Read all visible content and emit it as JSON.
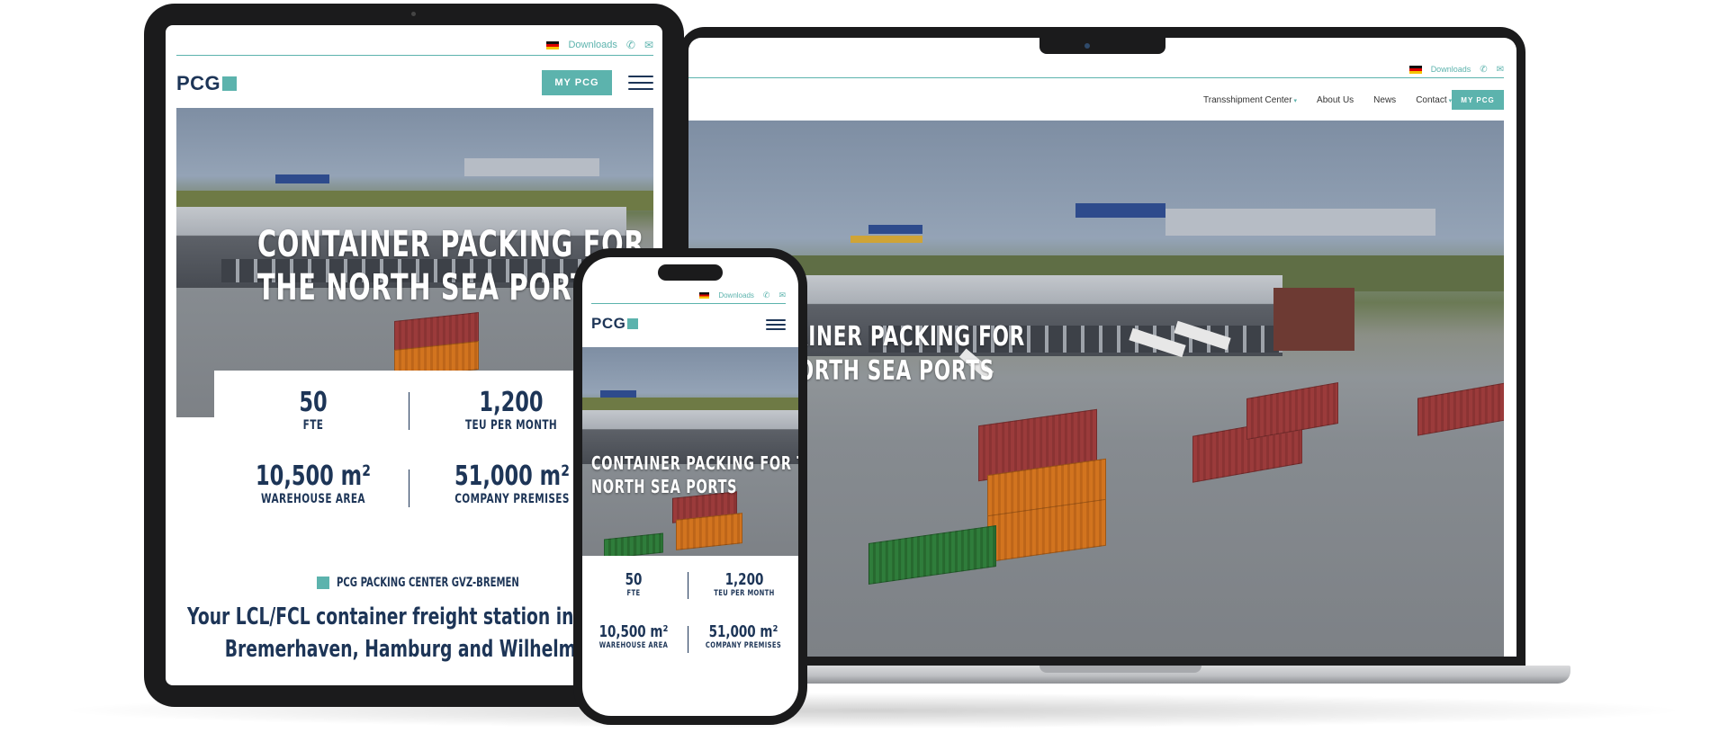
{
  "site": {
    "logo_text": "PCG",
    "downloads_label": "Downloads",
    "my_pcg_label": "MY PCG",
    "hero_title_line1": "CONTAINER PACKING FOR",
    "hero_title_line2": "THE NORTH SEA PORTS",
    "phone_hero_line1": "CONTAINER PACKING FOR THE",
    "phone_hero_line2": "NORTH SEA PORTS",
    "laptop_hero_line1": "TAINER PACKING FOR",
    "laptop_hero_line2": "NORTH SEA PORTS"
  },
  "nav": {
    "items": [
      "Transshipment Center",
      "About Us",
      "News",
      "Contact"
    ]
  },
  "stats": [
    {
      "value": "50",
      "label": "FTE"
    },
    {
      "value": "1,200",
      "label": "TEU PER MONTH"
    },
    {
      "value": "10,500 m²",
      "label": "WAREHOUSE AREA"
    },
    {
      "value": "51,000 m²",
      "label": "COMPANY PREMISES"
    }
  ],
  "intro": {
    "eyebrow": "PCG PACKING CENTER GVZ-BREMEN",
    "heading_line1": "Your LCL/FCL container freight station in Bre",
    "heading_line2": "Bremerhaven, Hamburg and Wilhelmshav"
  },
  "icons": {
    "flag": "germany-flag-icon",
    "phone": "phone-icon",
    "mail": "mail-icon",
    "menu": "hamburger-menu-icon",
    "chevron": "chevron-down-icon"
  },
  "colors": {
    "accent": "#5cb3ad",
    "navy": "#1d3557",
    "device_frame": "#1b1b1c"
  }
}
